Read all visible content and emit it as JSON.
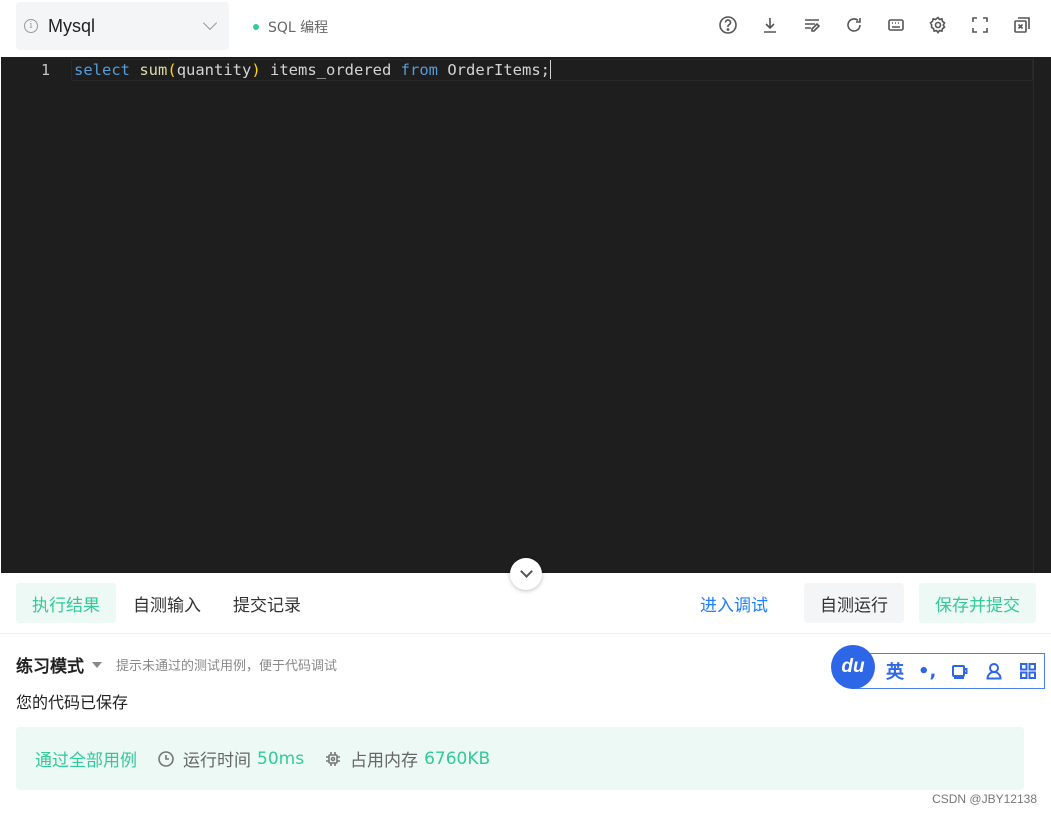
{
  "toolbar": {
    "language": "Mysql",
    "mode": "SQL 编程",
    "icons": [
      "help-icon",
      "download-icon",
      "format-icon",
      "reset-icon",
      "keyboard-icon",
      "settings-icon",
      "fullscreen-icon",
      "popout-icon"
    ]
  },
  "editor": {
    "line_number": "1",
    "code": {
      "kw_select": "select",
      "fn_sum": "sum",
      "paren_open": "(",
      "arg": "quantity",
      "paren_close": ")",
      "alias": " items_ordered ",
      "kw_from": "from",
      "table": " OrderItems;"
    }
  },
  "tabs": {
    "result": "执行结果",
    "custom_input": "自测输入",
    "history": "提交记录"
  },
  "actions": {
    "debug": "进入调试",
    "run": "自测运行",
    "submit": "保存并提交"
  },
  "result": {
    "practice_mode": "练习模式",
    "hint": "提示未通过的测试用例，便于代码调试",
    "saved_msg": "您的代码已保存",
    "pass": "通过全部用例",
    "runtime_label": "运行时间",
    "runtime_value": "50ms",
    "memory_label": "占用内存",
    "memory_value": "6760KB"
  },
  "ime": {
    "logo": "du",
    "lang": "英",
    "punct": "•,"
  },
  "watermark": "CSDN @JBY12138",
  "colors": {
    "accent_green": "#32ca99",
    "accent_blue": "#1e80ff",
    "editor_bg": "#1e1e1e"
  }
}
